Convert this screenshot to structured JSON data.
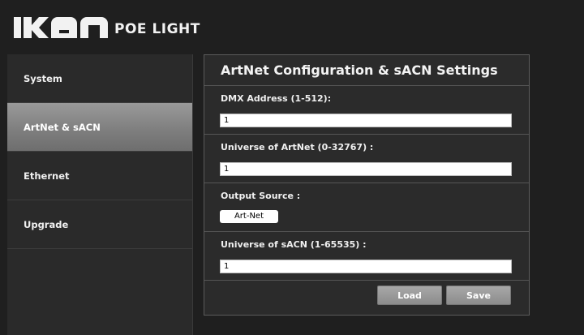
{
  "header": {
    "logo_text": "ikan",
    "product": "POE LIGHT"
  },
  "sidebar": {
    "items": [
      {
        "label": "System"
      },
      {
        "label": "ArtNet & sACN"
      },
      {
        "label": "Ethernet"
      },
      {
        "label": "Upgrade"
      }
    ],
    "active": "ArtNet & sACN"
  },
  "panel": {
    "title": "ArtNet Configuration & sACN Settings",
    "dmx": {
      "label": "DMX Address (1-512):",
      "value": "1"
    },
    "artnet_universe": {
      "label": "Universe of ArtNet (0-32767) :",
      "value": "1"
    },
    "output_source": {
      "label": "Output Source :",
      "value": "Art-Net"
    },
    "sacn_universe": {
      "label": "Universe of sACN (1-65535) :",
      "value": "1"
    },
    "load_label": "Load",
    "save_label": "Save"
  }
}
